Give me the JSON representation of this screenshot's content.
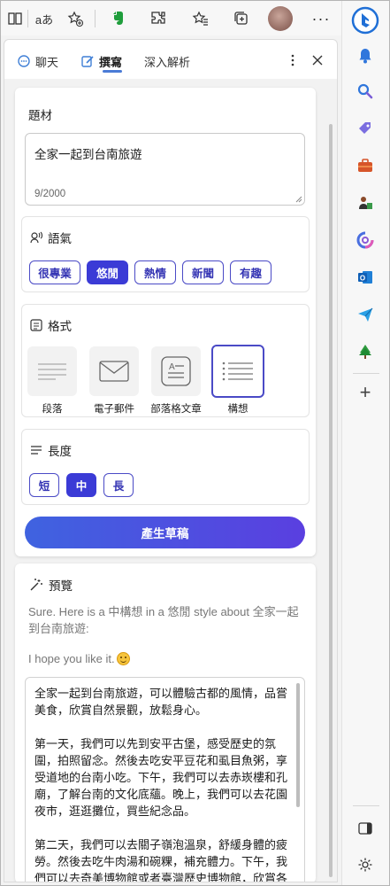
{
  "browser": {
    "toolbar_icons": [
      "reading-view-icon",
      "read-aloud-icon",
      "add-favorite-icon",
      "evernote-icon",
      "extensions-icon",
      "favorites-icon",
      "collections-icon",
      "profile-avatar",
      "more-icon",
      "bing-icon"
    ],
    "read_aloud_glyph": "aあ"
  },
  "rail": {
    "icons": [
      "bell-icon",
      "search-icon",
      "tag-icon",
      "briefcase-icon",
      "games-icon",
      "m365-icon",
      "outlook-icon",
      "send-icon",
      "tree-icon",
      "add-icon",
      "split-screen-icon",
      "settings-icon"
    ]
  },
  "panel": {
    "tabs": [
      {
        "label": "聊天",
        "icon": "chat-icon"
      },
      {
        "label": "撰寫",
        "icon": "compose-icon",
        "active": true
      },
      {
        "label": "深入解析",
        "icon": ""
      }
    ]
  },
  "compose": {
    "topic_label": "題材",
    "topic_text": "全家一起到台南旅遊",
    "counter": "9/2000",
    "tone": {
      "label": "語氣",
      "options": [
        "很專業",
        "悠閒",
        "熱情",
        "新聞",
        "有趣"
      ],
      "selected": "悠閒"
    },
    "format": {
      "label": "格式",
      "options": [
        "段落",
        "電子郵件",
        "部落格文章",
        "構想"
      ],
      "selected": "構想"
    },
    "length": {
      "label": "長度",
      "options": [
        "短",
        "中",
        "長"
      ],
      "selected": "中"
    },
    "generate_label": "產生草稿"
  },
  "preview": {
    "label": "預覽",
    "intro": "Sure. Here is a 中構想 in a 悠閒 style about 全家一起到台南旅遊:",
    "hope": "I hope you like it.",
    "draft": "全家一起到台南旅遊，可以體驗古都的風情，品嘗美食，欣賞自然景觀，放鬆身心。\n\n第一天，我們可以先到安平古堡，感受歷史的氛圍，拍照留念。然後去吃安平豆花和虱目魚粥，享受道地的台南小吃。下午，我們可以去赤崁樓和孔廟，了解台南的文化底蘊。晚上，我們可以去花園夜市，逛逛攤位，買些紀念品。\n\n第二天，我們可以去關子嶺泡溫泉，舒緩身體的疲勞。然後去吃牛肉湯和碗粿，補充體力。下午，我們可以去奇美博物館或者臺灣歷史博物館，欣賞各種展覽。晚上，我們可以去海安路藝"
  },
  "colors": {
    "accent": "#3b3bd6",
    "tab_underline": "#4a7bd6"
  }
}
